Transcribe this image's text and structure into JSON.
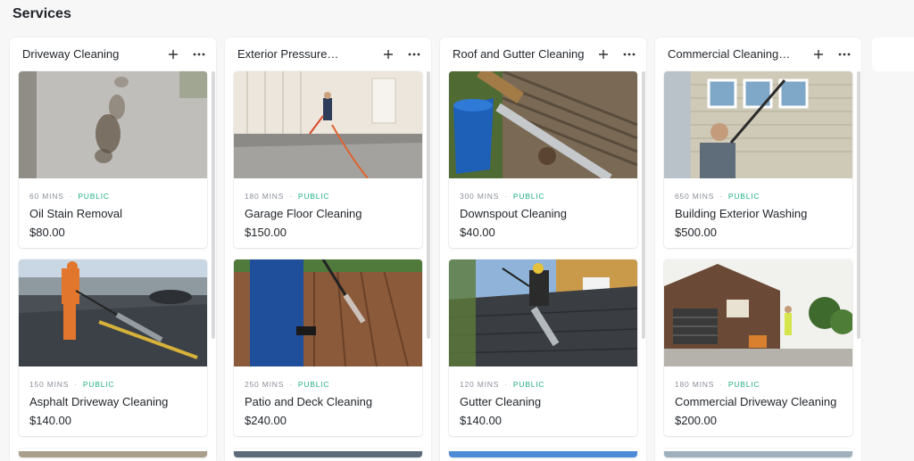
{
  "page": {
    "title": "Services"
  },
  "columns": [
    {
      "title": "Driveway Cleaning",
      "cards": [
        {
          "duration": "60 MINS",
          "visibility": "PUBLIC",
          "name": "Oil Stain Removal",
          "price": "$80.00"
        },
        {
          "duration": "150 MINS",
          "visibility": "PUBLIC",
          "name": "Asphalt Driveway Cleaning",
          "price": "$140.00"
        }
      ]
    },
    {
      "title": "Exterior Pressure…",
      "cards": [
        {
          "duration": "180 MINS",
          "visibility": "PUBLIC",
          "name": "Garage Floor Cleaning",
          "price": "$150.00"
        },
        {
          "duration": "250 MINS",
          "visibility": "PUBLIC",
          "name": "Patio and Deck Cleaning",
          "price": "$240.00"
        }
      ]
    },
    {
      "title": "Roof and Gutter Cleaning",
      "cards": [
        {
          "duration": "300 MINS",
          "visibility": "PUBLIC",
          "name": "Downspout Cleaning",
          "price": "$40.00"
        },
        {
          "duration": "120 MINS",
          "visibility": "PUBLIC",
          "name": "Gutter Cleaning",
          "price": "$140.00"
        }
      ]
    },
    {
      "title": "Commercial Cleaning…",
      "cards": [
        {
          "duration": "650 MINS",
          "visibility": "PUBLIC",
          "name": "Building Exterior Washing",
          "price": "$500.00"
        },
        {
          "duration": "180 MINS",
          "visibility": "PUBLIC",
          "name": "Commercial Driveway Cleaning",
          "price": "$200.00"
        }
      ]
    }
  ],
  "icons": {
    "add": "plus-icon",
    "more": "ellipsis-icon"
  },
  "colors": {
    "public_badge": "#22b07d",
    "background": "#f7f7f8"
  }
}
